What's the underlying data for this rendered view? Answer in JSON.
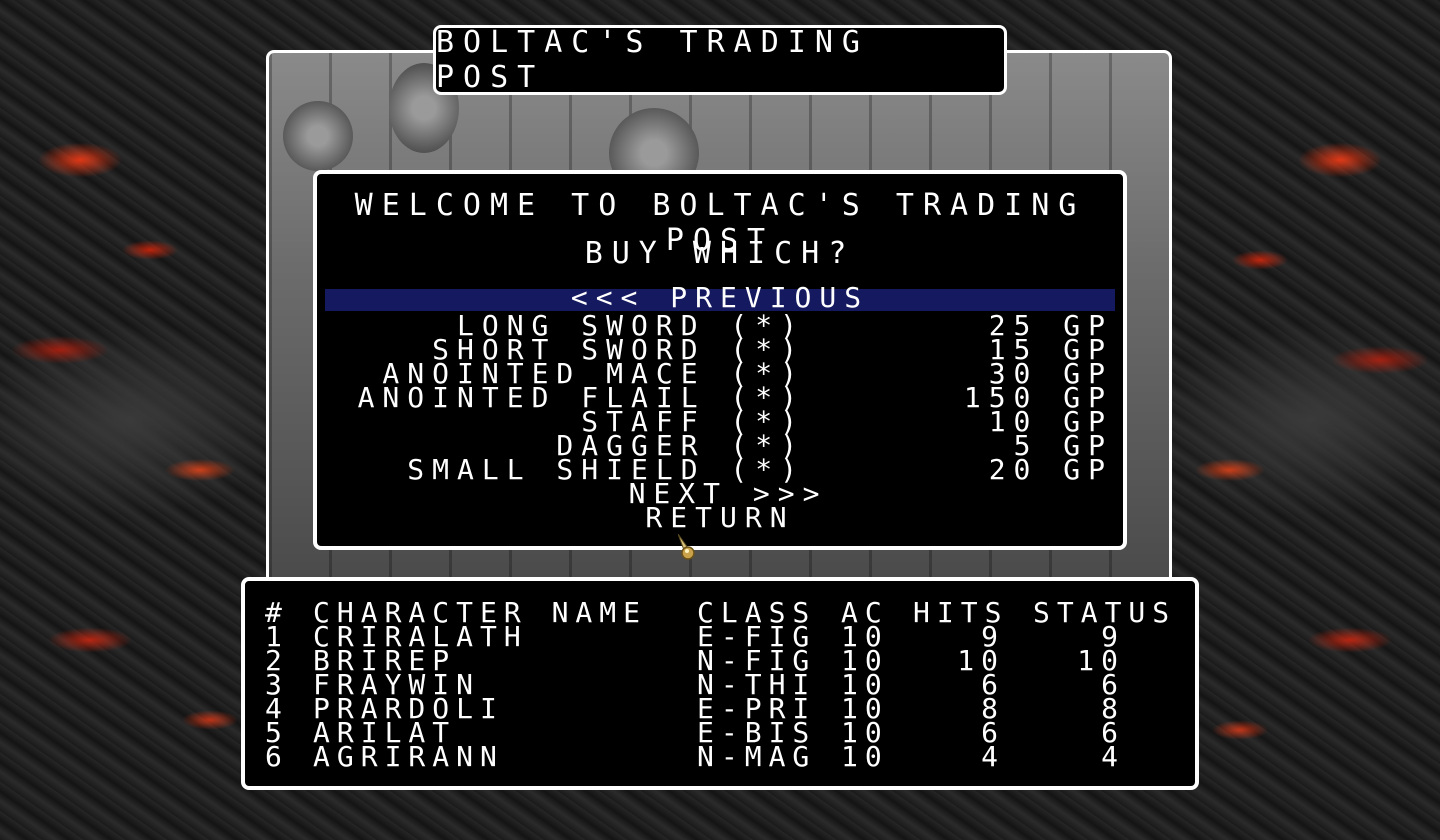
{
  "title": "BOLTAC'S TRADING POST",
  "menu": {
    "welcome": "WELCOME TO BOLTAC'S TRADING POST",
    "prompt": "BUY WHICH?",
    "previous": "<<< PREVIOUS",
    "items": [
      {
        "name": "LONG SWORD (*)",
        "price": "25 GP"
      },
      {
        "name": "SHORT SWORD (*)",
        "price": "15 GP"
      },
      {
        "name": "ANOINTED MACE (*)",
        "price": "30 GP"
      },
      {
        "name": "ANOINTED FLAIL (*)",
        "price": "150 GP"
      },
      {
        "name": "STAFF (*)",
        "price": "10 GP"
      },
      {
        "name": "DAGGER (*)",
        "price": "5 GP"
      },
      {
        "name": "SMALL SHIELD (*)",
        "price": "20 GP"
      }
    ],
    "next": "NEXT >>>",
    "return": "RETURN"
  },
  "party": {
    "headers": {
      "num": "#",
      "name": "CHARACTER NAME",
      "class": "CLASS",
      "ac": "AC",
      "hits": "HITS",
      "status": "STATUS"
    },
    "rows": [
      {
        "num": "1",
        "name": "CRIRALATH",
        "class": "E-FIG",
        "ac": "10",
        "hits": "9",
        "status": "9"
      },
      {
        "num": "2",
        "name": "BRIREP",
        "class": "N-FIG",
        "ac": "10",
        "hits": "10",
        "status": "10"
      },
      {
        "num": "3",
        "name": "FRAYWIN",
        "class": "N-THI",
        "ac": "10",
        "hits": "6",
        "status": "6"
      },
      {
        "num": "4",
        "name": "PRARDOLI",
        "class": "E-PRI",
        "ac": "10",
        "hits": "8",
        "status": "8"
      },
      {
        "num": "5",
        "name": "ARILAT",
        "class": "E-BIS",
        "ac": "10",
        "hits": "6",
        "status": "6"
      },
      {
        "num": "6",
        "name": "AGRIRANN",
        "class": "N-MAG",
        "ac": "10",
        "hits": "4",
        "status": "4"
      }
    ]
  },
  "colors": {
    "highlight": "#151a60",
    "border": "#ffffff",
    "panel": "#000000",
    "lava": "#ff3c14"
  },
  "icons": {
    "cursor": "sword-cursor-icon"
  }
}
